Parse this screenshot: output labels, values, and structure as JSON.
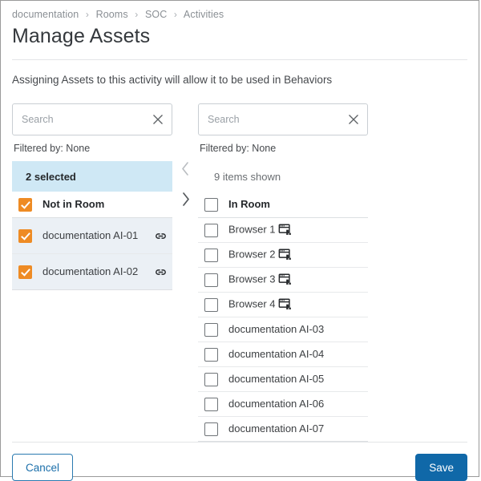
{
  "breadcrumb": {
    "separator": "›",
    "items": [
      {
        "label": "documentation"
      },
      {
        "label": "Rooms"
      },
      {
        "label": "SOC"
      },
      {
        "label": "Activities"
      }
    ]
  },
  "page": {
    "title": "Manage Assets",
    "subtitle": "Assigning Assets to this activity will allow it to be used in Behaviors"
  },
  "left_panel": {
    "search": {
      "value": "",
      "placeholder": "Search"
    },
    "clear_icon": "close-icon",
    "filtered_by": "Filtered by: None",
    "count_label": "2 selected",
    "header_row": {
      "label": "Not in Room",
      "checked": true
    },
    "items": [
      {
        "label": "documentation AI-01",
        "checked": true,
        "icon": "link-icon",
        "selected": true
      },
      {
        "label": "documentation AI-02",
        "checked": true,
        "icon": "link-icon",
        "selected": true
      }
    ]
  },
  "arrows": {
    "move_left": {
      "icon": "chevron-left-icon",
      "enabled": false
    },
    "move_right": {
      "icon": "chevron-right-icon",
      "enabled": true
    }
  },
  "right_panel": {
    "search": {
      "value": "",
      "placeholder": "Search"
    },
    "clear_icon": "close-icon",
    "filtered_by": "Filtered by: None",
    "count_label": "9 items shown",
    "header_row": {
      "label": "In Room",
      "checked": false
    },
    "items": [
      {
        "label": "Browser 1",
        "checked": false,
        "icon": "browser-window-icon"
      },
      {
        "label": "Browser 2",
        "checked": false,
        "icon": "browser-window-icon"
      },
      {
        "label": "Browser 3",
        "checked": false,
        "icon": "browser-window-icon"
      },
      {
        "label": "Browser 4",
        "checked": false,
        "icon": "browser-window-icon"
      },
      {
        "label": "documentation AI-03",
        "checked": false,
        "icon": null
      },
      {
        "label": "documentation AI-04",
        "checked": false,
        "icon": null
      },
      {
        "label": "documentation AI-05",
        "checked": false,
        "icon": null
      },
      {
        "label": "documentation AI-06",
        "checked": false,
        "icon": null
      },
      {
        "label": "documentation AI-07",
        "checked": false,
        "icon": null
      }
    ]
  },
  "footer": {
    "cancel_label": "Cancel",
    "save_label": "Save"
  },
  "colors": {
    "accent_orange": "#ee8b24",
    "primary_blue": "#1068a8",
    "selected_header_bg": "#cfe8f5",
    "selected_row_bg": "#ebf0f5",
    "link_blue": "#1b6faa"
  }
}
